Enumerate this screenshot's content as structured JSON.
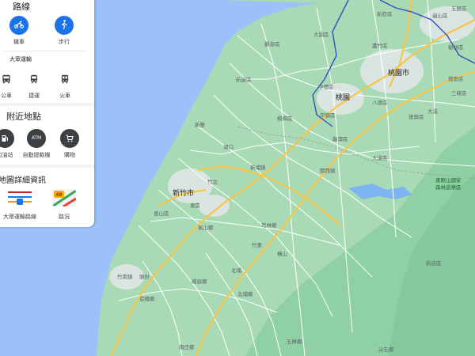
{
  "panel": {
    "routes": {
      "title": "路線",
      "modes": [
        {
          "label": "機車",
          "icon": "motorcycle-icon"
        },
        {
          "label": "步行",
          "icon": "walking-icon"
        }
      ]
    },
    "transit": {
      "title": "大眾運輸",
      "modes": [
        {
          "label": "公車",
          "icon": "bus-icon"
        },
        {
          "label": "捷運",
          "icon": "metro-icon"
        },
        {
          "label": "火車",
          "icon": "train-icon"
        }
      ]
    },
    "nearby": {
      "title": "附近地點",
      "items": [
        {
          "label": "加油站",
          "icon": "gas-station-icon"
        },
        {
          "label": "自動提款機",
          "icon": "atm-icon",
          "badge": "ATM"
        },
        {
          "label": "購物",
          "icon": "shopping-cart-icon"
        }
      ]
    },
    "details": {
      "title": "地圖詳細資訊",
      "layers": [
        {
          "label": "大眾運輸路線",
          "icon": "transit-layer-icon"
        },
        {
          "label": "路況",
          "icon": "traffic-layer-icon",
          "badge": "48"
        }
      ]
    }
  },
  "map": {
    "colors": {
      "sea": "#9cc0f9",
      "land": "#a8dab5",
      "mountain": "#8fd0a4",
      "urban": "#e8eaed",
      "highway": "#f9c94e",
      "road": "#ffffff",
      "boundary": "#3b4cbd"
    },
    "cities": [
      "桃園市",
      "桃園",
      "新竹市"
    ],
    "towns": [
      "大園區",
      "蘆竹區",
      "觀音區",
      "新屋區",
      "中壢區",
      "平鎮區",
      "八德區",
      "大溪區",
      "楊梅區",
      "新豐",
      "湖口",
      "新埔鎮",
      "關西鎮",
      "竹北",
      "竹東",
      "芎林鄉",
      "橫山",
      "寶山鄉",
      "北埔",
      "峨眉鄉",
      "北埔鄉",
      "五峰鄉",
      "尖石鄉",
      "竹南鎮",
      "頭份",
      "造橋鄉",
      "南庄鄉",
      "復興區",
      "大溪",
      "龜山區",
      "鶯歌區",
      "三峽區",
      "樹林區",
      "五股區",
      "新莊區",
      "新店區",
      "龍潭區",
      "香山區",
      "東區"
    ],
    "park": [
      "東眼山國家",
      "森林遊樂區"
    ]
  }
}
